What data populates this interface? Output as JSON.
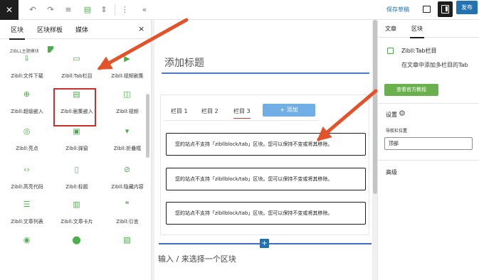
{
  "toolbar": {
    "close_icon": "close-icon",
    "save_draft": "保存草稿",
    "publish": "发布"
  },
  "left_panel": {
    "tabs": [
      {
        "label": "区块"
      },
      {
        "label": "区块样板"
      },
      {
        "label": "媒体"
      }
    ],
    "close": "×",
    "section_title": "ZIBLL主题模块",
    "blocks": [
      {
        "label": "Zibll:文件下载",
        "icon": "download-folder-icon",
        "glyph": "⇩"
      },
      {
        "label": "Zibll:Tab栏目",
        "icon": "tab-icon",
        "glyph": "▭"
      },
      {
        "label": "Zibll:视频剧集",
        "icon": "video-icon",
        "glyph": "▶"
      },
      {
        "label": "Zibll:超级嵌入",
        "icon": "embed-icon",
        "glyph": "⊕"
      },
      {
        "label": "Zibll:剧集嵌入",
        "icon": "episode-icon",
        "glyph": "▤"
      },
      {
        "label": "Zibll:视频",
        "icon": "video-camera-icon",
        "glyph": "◫"
      },
      {
        "label": "Zibll:亮点",
        "icon": "highlight-icon",
        "glyph": "◎"
      },
      {
        "label": "Zibll:弹窗",
        "icon": "popup-icon",
        "glyph": "▣"
      },
      {
        "label": "Zibll:折叠框",
        "icon": "collapse-icon",
        "glyph": "▾"
      },
      {
        "label": "Zibll:高亮代码",
        "icon": "code-icon",
        "glyph": "‹›"
      },
      {
        "label": "Zibll:标题",
        "icon": "bookmark-icon",
        "glyph": "▯"
      },
      {
        "label": "Zibll:隐藏内容",
        "icon": "hidden-content-icon",
        "glyph": "⊘"
      },
      {
        "label": "Zibll:文章列表",
        "icon": "post-list-icon",
        "glyph": "☰"
      },
      {
        "label": "Zibll:文章卡片",
        "icon": "post-card-icon",
        "glyph": "▥"
      },
      {
        "label": "Zibll:引言",
        "icon": "quote-icon",
        "glyph": "❝"
      },
      {
        "label": "",
        "icon": "globe-icon",
        "glyph": "◉"
      },
      {
        "label": "",
        "icon": "pin-icon",
        "glyph": "⬤"
      },
      {
        "label": "",
        "icon": "image-icon",
        "glyph": "▧"
      }
    ]
  },
  "editor": {
    "post_title": "添加标题",
    "tabs": [
      {
        "label": "栏目 1"
      },
      {
        "label": "栏目 2"
      },
      {
        "label": "栏目 3"
      }
    ],
    "add_tab": "+ 添加",
    "notices": [
      "您的站点不支持「zibllblock/tab」区块。您可以保持不变或将其移除。",
      "您的站点不支持「zibllblock/tab」区块。您可以保持不变或将其移除。",
      "您的站点不支持「zibllblock/tab」区块。您可以保持不变或将其移除。"
    ],
    "appender_placeholder": "输入 / 来选择一个区块",
    "insert_plus": "+"
  },
  "right_panel": {
    "tabs": [
      {
        "label": "文章"
      },
      {
        "label": "区块"
      }
    ],
    "block_title": "Zibll:Tab栏目",
    "block_desc": "在文章中添加多栏目的Tab",
    "guide_button": "查看官方教程",
    "settings_label": "设置",
    "nav_position_label": "导航栏位置",
    "nav_position_value": "顶部",
    "advanced_label": "高级"
  },
  "colors": {
    "accent": "#2271b1",
    "annotation_red": "#e2532b",
    "brand_green": "#6ab04c",
    "tab_add": "#72aee6"
  }
}
